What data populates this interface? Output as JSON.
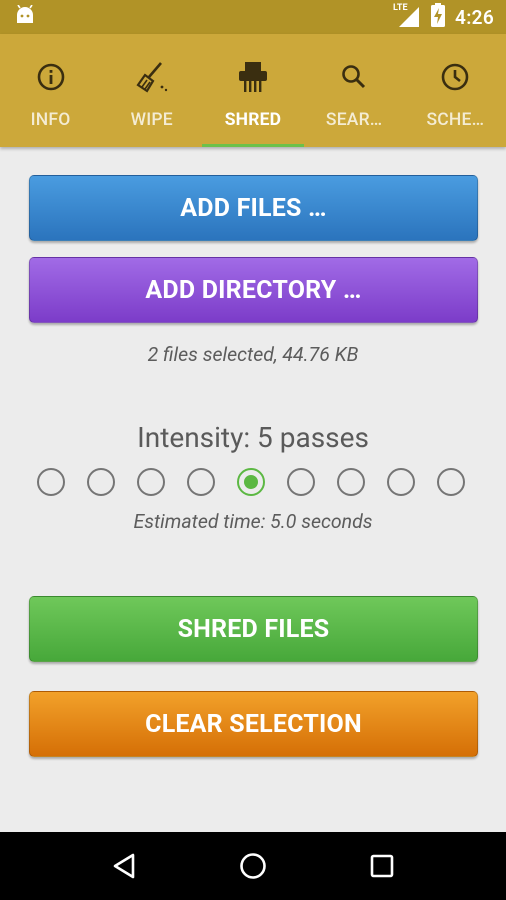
{
  "status_bar": {
    "time": "4:26",
    "network_label": "LTE",
    "icons": [
      "android-debug-icon",
      "lte-signal-icon",
      "battery-charging-icon"
    ]
  },
  "tabs": [
    {
      "label": "INFO",
      "icon": "info-icon",
      "active": false
    },
    {
      "label": "WIPE",
      "icon": "broom-icon",
      "active": false
    },
    {
      "label": "SHRED",
      "icon": "shredder-icon",
      "active": true
    },
    {
      "label": "SEAR…",
      "icon": "search-icon",
      "active": false
    },
    {
      "label": "SCHE…",
      "icon": "clock-icon",
      "active": false
    }
  ],
  "buttons": {
    "add_files": "ADD FILES …",
    "add_directory": "ADD DIRECTORY …",
    "shred_files": "SHRED FILES",
    "clear_selection": "CLEAR SELECTION"
  },
  "selection_info": "2 files selected, 44.76 KB",
  "intensity": {
    "label": "Intensity: 5 passes",
    "options": 9,
    "selected": 5,
    "estimated_time": "Estimated time: 5.0 seconds"
  },
  "nav_bar": {
    "icons": [
      "back-icon",
      "home-icon",
      "recents-icon"
    ]
  },
  "colors": {
    "status_bar": "#b19327",
    "tab_bar": "#cca83a",
    "tab_indicator": "#6cc14a",
    "btn_blue": "#3a87d0",
    "btn_purple": "#8d50d8",
    "btn_green": "#5ab84a",
    "btn_orange": "#e58818",
    "radio_selected": "#5cb843"
  }
}
